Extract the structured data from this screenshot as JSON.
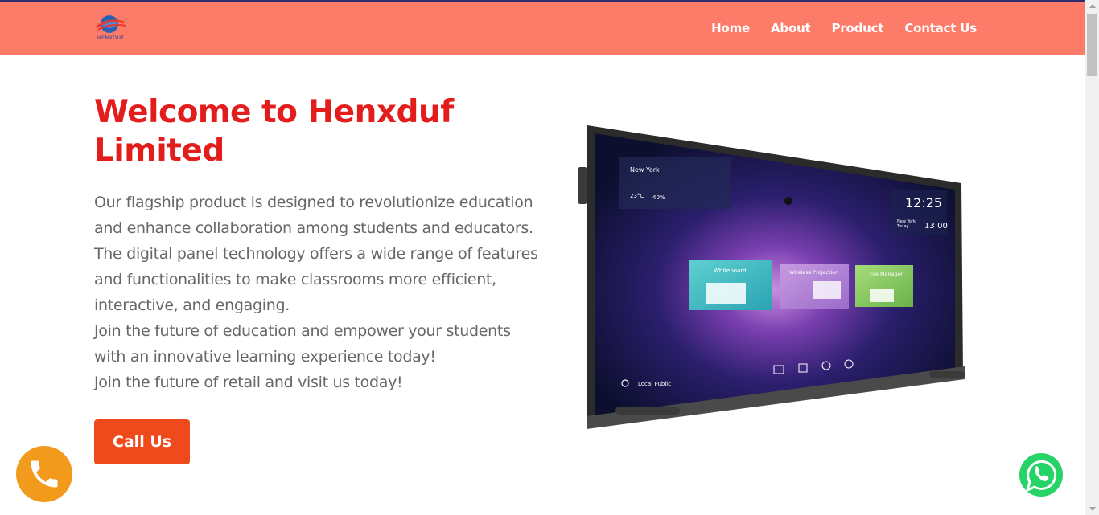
{
  "brand": {
    "logo_icon": "globe-logo-icon",
    "logo_text": "HENXDUF"
  },
  "nav": {
    "items": [
      {
        "label": "Home"
      },
      {
        "label": "About"
      },
      {
        "label": "Product"
      },
      {
        "label": "Contact Us"
      }
    ]
  },
  "hero": {
    "title": "Welcome to Henxduf Limited",
    "paragraphs": [
      "Our flagship product is designed to revolutionize education and enhance collaboration among students and educators. The digital panel technology offers a wide range of features and functionalities to make classrooms more efficient, interactive, and engaging.",
      "Join the future of education and empower your students with an innovative learning experience today!",
      "Join the future of retail and visit us today!"
    ],
    "call_label": "Call Us"
  },
  "panel_screen": {
    "city": "New York",
    "temp": "23°C",
    "humidity": "40%",
    "time": "12:25",
    "second_city": "New York",
    "second_day": "Today",
    "second_time": "13:00",
    "apps": [
      "Whiteboard",
      "Wireless Projection",
      "File Manager"
    ],
    "user_label": "Local Public"
  },
  "floating": {
    "phone_icon": "phone-icon",
    "whatsapp_icon": "whatsapp-icon"
  },
  "colors": {
    "header_bg": "#fc7b69",
    "title": "#e31c1c",
    "button": "#ef4a1c",
    "phone_fab": "#f19a1c",
    "whatsapp": "#25d366"
  }
}
